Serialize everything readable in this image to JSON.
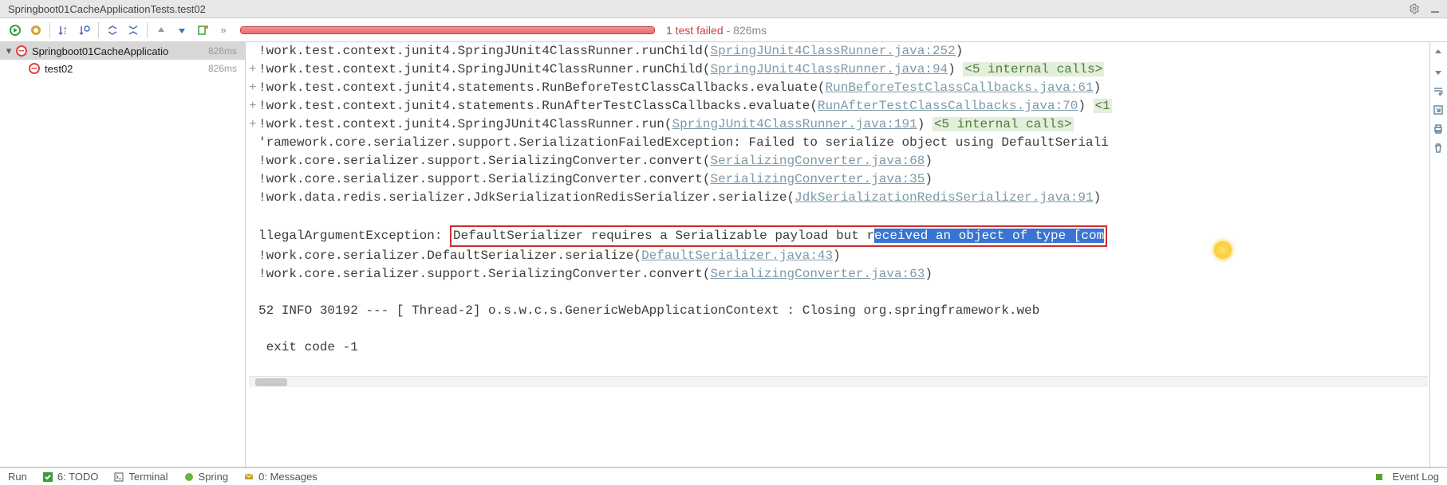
{
  "title": "Springboot01CacheApplicationTests.test02",
  "toolbar": {
    "status_fail": "1 test failed",
    "status_time": "- 826ms",
    "progress_pct": 100
  },
  "tree": {
    "root": {
      "label": "Springboot01CacheApplicatio",
      "time": "826ms"
    },
    "child": {
      "label": "test02",
      "time": "826ms"
    }
  },
  "console": {
    "lines": [
      {
        "gutter": "",
        "pre": "!work.test.context.junit4.SpringJUnit4ClassRunner.runChild(",
        "link": "SpringJUnit4ClassRunner.java:252",
        "post": ")"
      },
      {
        "gutter": "+",
        "pre": "!work.test.context.junit4.SpringJUnit4ClassRunner.runChild(",
        "link": "SpringJUnit4ClassRunner.java:94",
        "post": ") ",
        "badge": "<5 internal calls>"
      },
      {
        "gutter": "+",
        "pre": "!work.test.context.junit4.statements.RunBeforeTestClassCallbacks.evaluate(",
        "link": "RunBeforeTestClassCallbacks.java:61",
        "post": ")"
      },
      {
        "gutter": "+",
        "pre": "!work.test.context.junit4.statements.RunAfterTestClassCallbacks.evaluate(",
        "link": "RunAfterTestClassCallbacks.java:70",
        "post": ") ",
        "badge": "<1"
      },
      {
        "gutter": "+",
        "pre": "!work.test.context.junit4.SpringJUnit4ClassRunner.run(",
        "link": "SpringJUnit4ClassRunner.java:191",
        "post": ") ",
        "badge": "<5 internal calls>"
      },
      {
        "gutter": "",
        "pre": "'ramework.core.serializer.support.SerializationFailedException: Failed to serialize object using DefaultSeriali"
      },
      {
        "gutter": "",
        "pre": "!work.core.serializer.support.SerializingConverter.convert(",
        "link": "SerializingConverter.java:68",
        "post": ")"
      },
      {
        "gutter": "",
        "pre": "!work.core.serializer.support.SerializingConverter.convert(",
        "link": "SerializingConverter.java:35",
        "post": ")"
      },
      {
        "gutter": "",
        "pre": "!work.data.redis.serializer.JdkSerializationRedisSerializer.serialize(",
        "link": "JdkSerializationRedisSerializer.java:91",
        "post": ")"
      },
      {
        "blank": true
      },
      {
        "exc_pre": "llegalArgumentException: ",
        "hl_a": "DefaultSerializer requires a Serializable payload but r",
        "hl_b": "eceived an object of type [com"
      },
      {
        "gutter": "",
        "pre": "!work.core.serializer.DefaultSerializer.serialize(",
        "link": "DefaultSerializer.java:43",
        "post": ")"
      },
      {
        "gutter": "",
        "pre": "!work.core.serializer.support.SerializingConverter.convert(",
        "link": "SerializingConverter.java:63",
        "post": ")"
      },
      {
        "blank": true
      },
      {
        "log": "52  INFO 30192 --- [       Thread-2] o.s.w.c.s.GenericWebApplicationContext   : Closing org.springframework.web"
      },
      {
        "blank": true
      },
      {
        "log": " exit code -1"
      }
    ]
  },
  "bottom": {
    "run": "Run",
    "todo": "6: TODO",
    "terminal": "Terminal",
    "spring": "Spring",
    "messages": "0: Messages",
    "eventlog": "Event Log"
  }
}
